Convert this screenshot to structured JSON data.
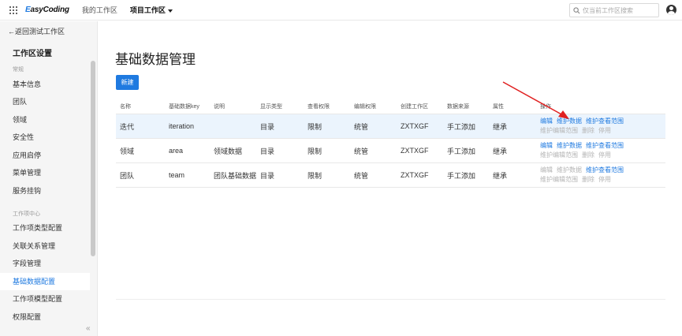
{
  "header": {
    "logo": "EasyCoding",
    "nav": [
      "我的工作区",
      "项目工作区"
    ],
    "search_placeholder": "仅当前工作区搜索"
  },
  "sidebar": {
    "back": "←返回测试工作区",
    "title": "工作区设置",
    "group1": "常规",
    "items1": [
      "基本信息",
      "团队",
      "领域",
      "安全性",
      "应用启停",
      "菜单管理",
      "服务挂钩"
    ],
    "group2": "工作项中心",
    "items2": [
      "工作项类型配置",
      "关联关系管理",
      "字段管理",
      "基础数据配置",
      "工作项模型配置",
      "权限配置"
    ],
    "active": "基础数据配置",
    "collapse": "«"
  },
  "main": {
    "title": "基础数据管理",
    "new_button": "新建",
    "columns": [
      "名称",
      "基础数据key",
      "说明",
      "显示类型",
      "查看权限",
      "编辑权限",
      "创建工作区",
      "数据来源",
      "属性",
      "操作"
    ],
    "rows": [
      {
        "cells": [
          "迭代",
          "iteration",
          "",
          "目录",
          "限制",
          "统管",
          "ZXTXGF",
          "手工添加",
          "继承"
        ],
        "ops_line1": [
          {
            "label": "编辑",
            "enabled": true
          },
          {
            "label": "维护数据",
            "enabled": true
          },
          {
            "label": "维护查看范围",
            "enabled": true
          }
        ],
        "ops_line2": [
          {
            "label": "维护编辑范围",
            "enabled": false
          },
          {
            "label": "删除",
            "enabled": false
          },
          {
            "label": "停用",
            "enabled": false
          }
        ]
      },
      {
        "cells": [
          "领域",
          "area",
          "领域数据",
          "目录",
          "限制",
          "统管",
          "ZXTXGF",
          "手工添加",
          "继承"
        ],
        "ops_line1": [
          {
            "label": "编辑",
            "enabled": true
          },
          {
            "label": "维护数据",
            "enabled": true
          },
          {
            "label": "维护查看范围",
            "enabled": true
          }
        ],
        "ops_line2": [
          {
            "label": "维护编辑范围",
            "enabled": false
          },
          {
            "label": "删除",
            "enabled": false
          },
          {
            "label": "停用",
            "enabled": false
          }
        ]
      },
      {
        "cells": [
          "团队",
          "team",
          "团队基础数据",
          "目录",
          "限制",
          "统管",
          "ZXTXGF",
          "手工添加",
          "继承"
        ],
        "ops_line1": [
          {
            "label": "编辑",
            "enabled": false
          },
          {
            "label": "维护数据",
            "enabled": false
          },
          {
            "label": "维护查看范围",
            "enabled": true
          }
        ],
        "ops_line2": [
          {
            "label": "维护编辑范围",
            "enabled": false
          },
          {
            "label": "删除",
            "enabled": false
          },
          {
            "label": "停用",
            "enabled": false
          }
        ]
      }
    ]
  },
  "colors": {
    "accent": "#1f7ae0",
    "highlight_row": "#ebf4fd",
    "disabled": "#b4b4b4",
    "annotation_arrow": "#e02020"
  }
}
